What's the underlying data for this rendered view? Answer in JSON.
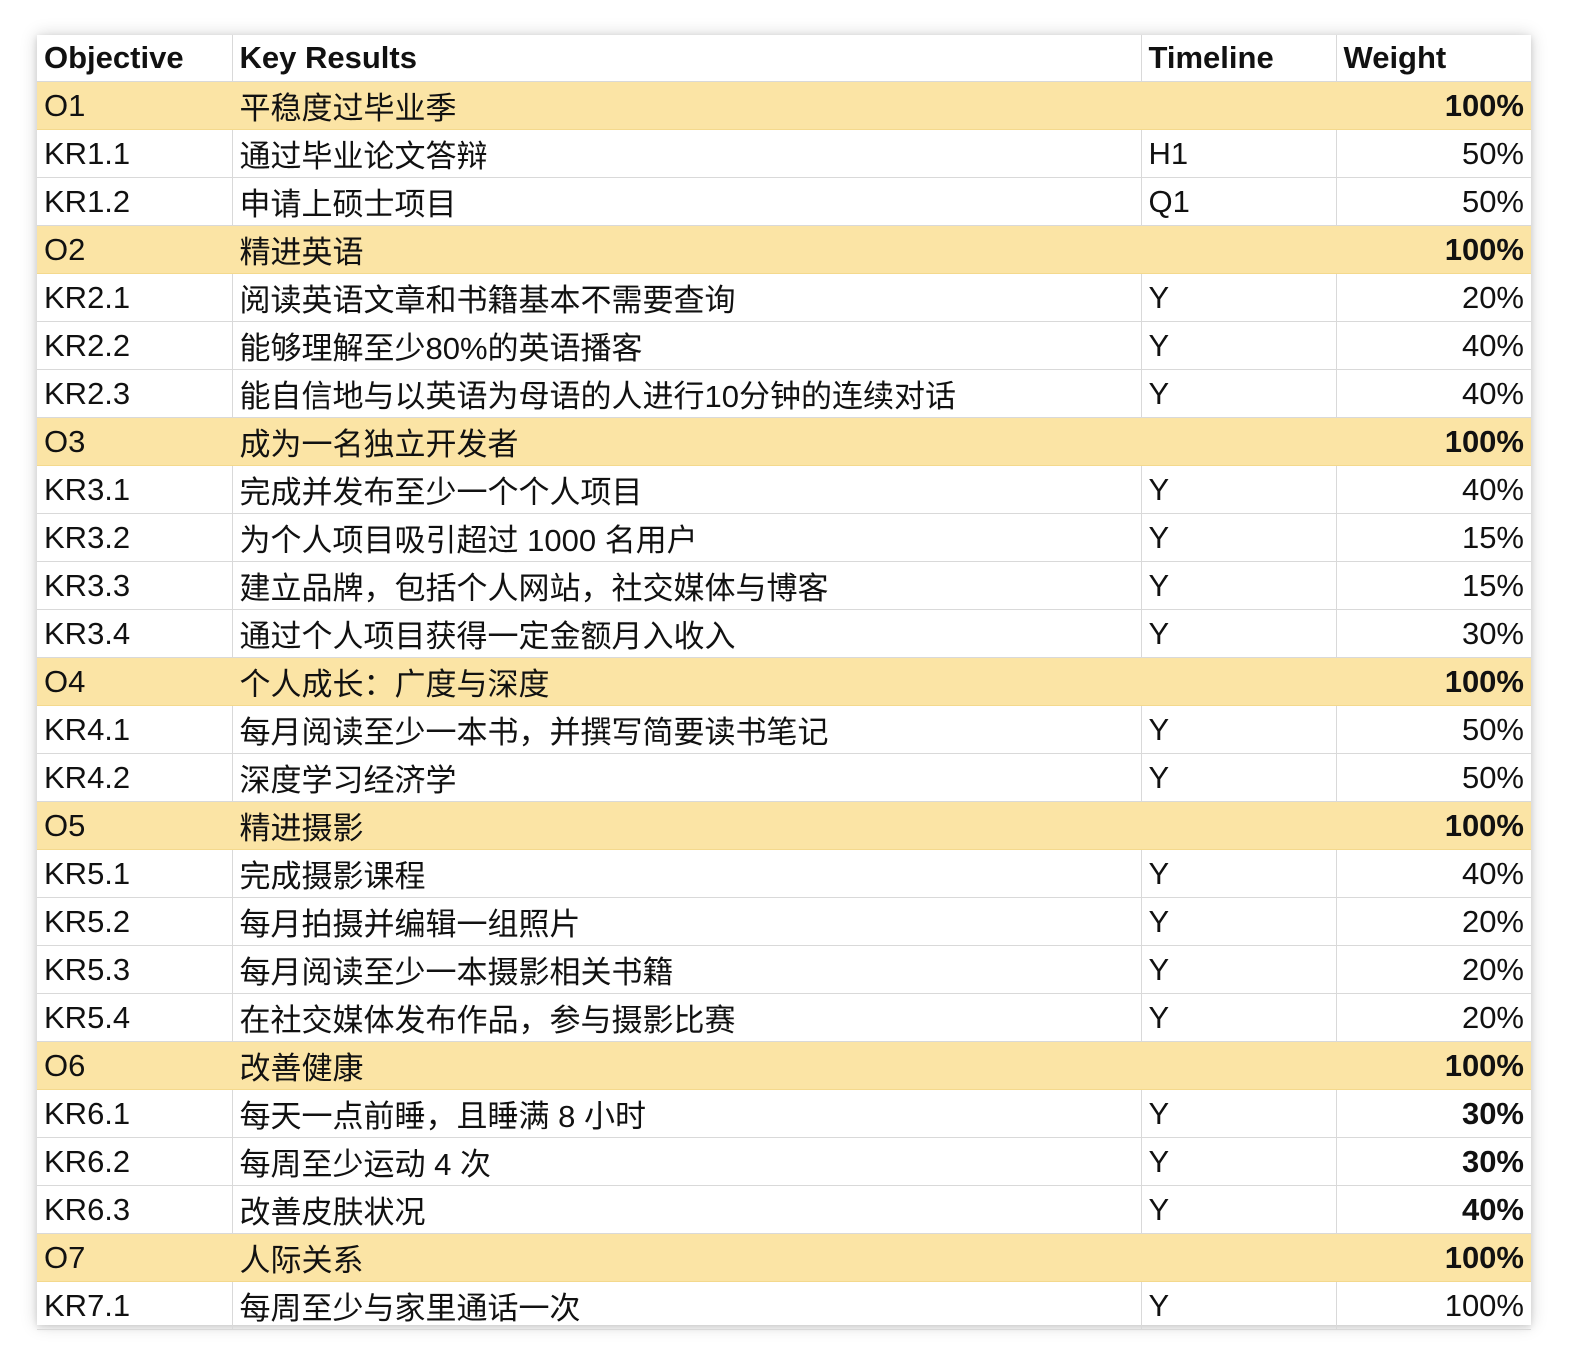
{
  "headers": {
    "objective": "Objective",
    "key_results": "Key Results",
    "timeline": "Timeline",
    "weight": "Weight"
  },
  "rows": [
    {
      "type": "objective",
      "id": "O1",
      "text": "平稳度过毕业季",
      "timeline": "",
      "weight": "100%",
      "bold_weight": true
    },
    {
      "type": "kr",
      "id": "KR1.1",
      "text": "通过毕业论文答辩",
      "timeline": "H1",
      "weight": "50%",
      "bold_weight": false
    },
    {
      "type": "kr",
      "id": "KR1.2",
      "text": "申请上硕士项目",
      "timeline": "Q1",
      "weight": "50%",
      "bold_weight": false
    },
    {
      "type": "objective",
      "id": "O2",
      "text": "精进英语",
      "timeline": "",
      "weight": "100%",
      "bold_weight": true
    },
    {
      "type": "kr",
      "id": "KR2.1",
      "text": "阅读英语文章和书籍基本不需要查询",
      "timeline": "Y",
      "weight": "20%",
      "bold_weight": false
    },
    {
      "type": "kr",
      "id": "KR2.2",
      "text": "能够理解至少80%的英语播客",
      "timeline": "Y",
      "weight": "40%",
      "bold_weight": false
    },
    {
      "type": "kr",
      "id": "KR2.3",
      "text": "能自信地与以英语为母语的人进行10分钟的连续对话",
      "timeline": "Y",
      "weight": "40%",
      "bold_weight": false
    },
    {
      "type": "objective",
      "id": "O3",
      "text": "成为一名独立开发者",
      "timeline": "",
      "weight": "100%",
      "bold_weight": true
    },
    {
      "type": "kr",
      "id": "KR3.1",
      "text": "完成并发布至少一个个人项目",
      "timeline": "Y",
      "weight": "40%",
      "bold_weight": false
    },
    {
      "type": "kr",
      "id": "KR3.2",
      "text": "为个人项目吸引超过 1000 名用户",
      "timeline": "Y",
      "weight": "15%",
      "bold_weight": false
    },
    {
      "type": "kr",
      "id": "KR3.3",
      "text": "建立品牌，包括个人网站，社交媒体与博客",
      "timeline": "Y",
      "weight": "15%",
      "bold_weight": false
    },
    {
      "type": "kr",
      "id": "KR3.4",
      "text": "通过个人项目获得一定金额月入收入",
      "timeline": "Y",
      "weight": "30%",
      "bold_weight": false
    },
    {
      "type": "objective",
      "id": "O4",
      "text": "个人成长：广度与深度",
      "timeline": "",
      "weight": "100%",
      "bold_weight": true
    },
    {
      "type": "kr",
      "id": "KR4.1",
      "text": "每月阅读至少一本书，并撰写简要读书笔记",
      "timeline": "Y",
      "weight": "50%",
      "bold_weight": false
    },
    {
      "type": "kr",
      "id": "KR4.2",
      "text": "深度学习经济学",
      "timeline": "Y",
      "weight": "50%",
      "bold_weight": false
    },
    {
      "type": "objective",
      "id": "O5",
      "text": "精进摄影",
      "timeline": "",
      "weight": "100%",
      "bold_weight": true
    },
    {
      "type": "kr",
      "id": "KR5.1",
      "text": "完成摄影课程",
      "timeline": "Y",
      "weight": "40%",
      "bold_weight": false
    },
    {
      "type": "kr",
      "id": "KR5.2",
      "text": "每月拍摄并编辑一组照片",
      "timeline": "Y",
      "weight": "20%",
      "bold_weight": false
    },
    {
      "type": "kr",
      "id": "KR5.3",
      "text": "每月阅读至少一本摄影相关书籍",
      "timeline": "Y",
      "weight": "20%",
      "bold_weight": false
    },
    {
      "type": "kr",
      "id": "KR5.4",
      "text": "在社交媒体发布作品，参与摄影比赛",
      "timeline": "Y",
      "weight": "20%",
      "bold_weight": false
    },
    {
      "type": "objective",
      "id": "O6",
      "text": "改善健康",
      "timeline": "",
      "weight": "100%",
      "bold_weight": true
    },
    {
      "type": "kr",
      "id": "KR6.1",
      "text": "每天一点前睡，且睡满 8 小时",
      "timeline": "Y",
      "weight": "30%",
      "bold_weight": true
    },
    {
      "type": "kr",
      "id": "KR6.2",
      "text": "每周至少运动 4 次",
      "timeline": "Y",
      "weight": "30%",
      "bold_weight": true
    },
    {
      "type": "kr",
      "id": "KR6.3",
      "text": "改善皮肤状况",
      "timeline": "Y",
      "weight": "40%",
      "bold_weight": true
    },
    {
      "type": "objective",
      "id": "O7",
      "text": "人际关系",
      "timeline": "",
      "weight": "100%",
      "bold_weight": true
    },
    {
      "type": "kr",
      "id": "KR7.1",
      "text": "每周至少与家里通话一次",
      "timeline": "Y",
      "weight": "100%",
      "bold_weight": false
    }
  ],
  "colors": {
    "objective_row_bg": "#fbe4a5",
    "grid_line": "#d9d9d9",
    "text": "#111111"
  }
}
